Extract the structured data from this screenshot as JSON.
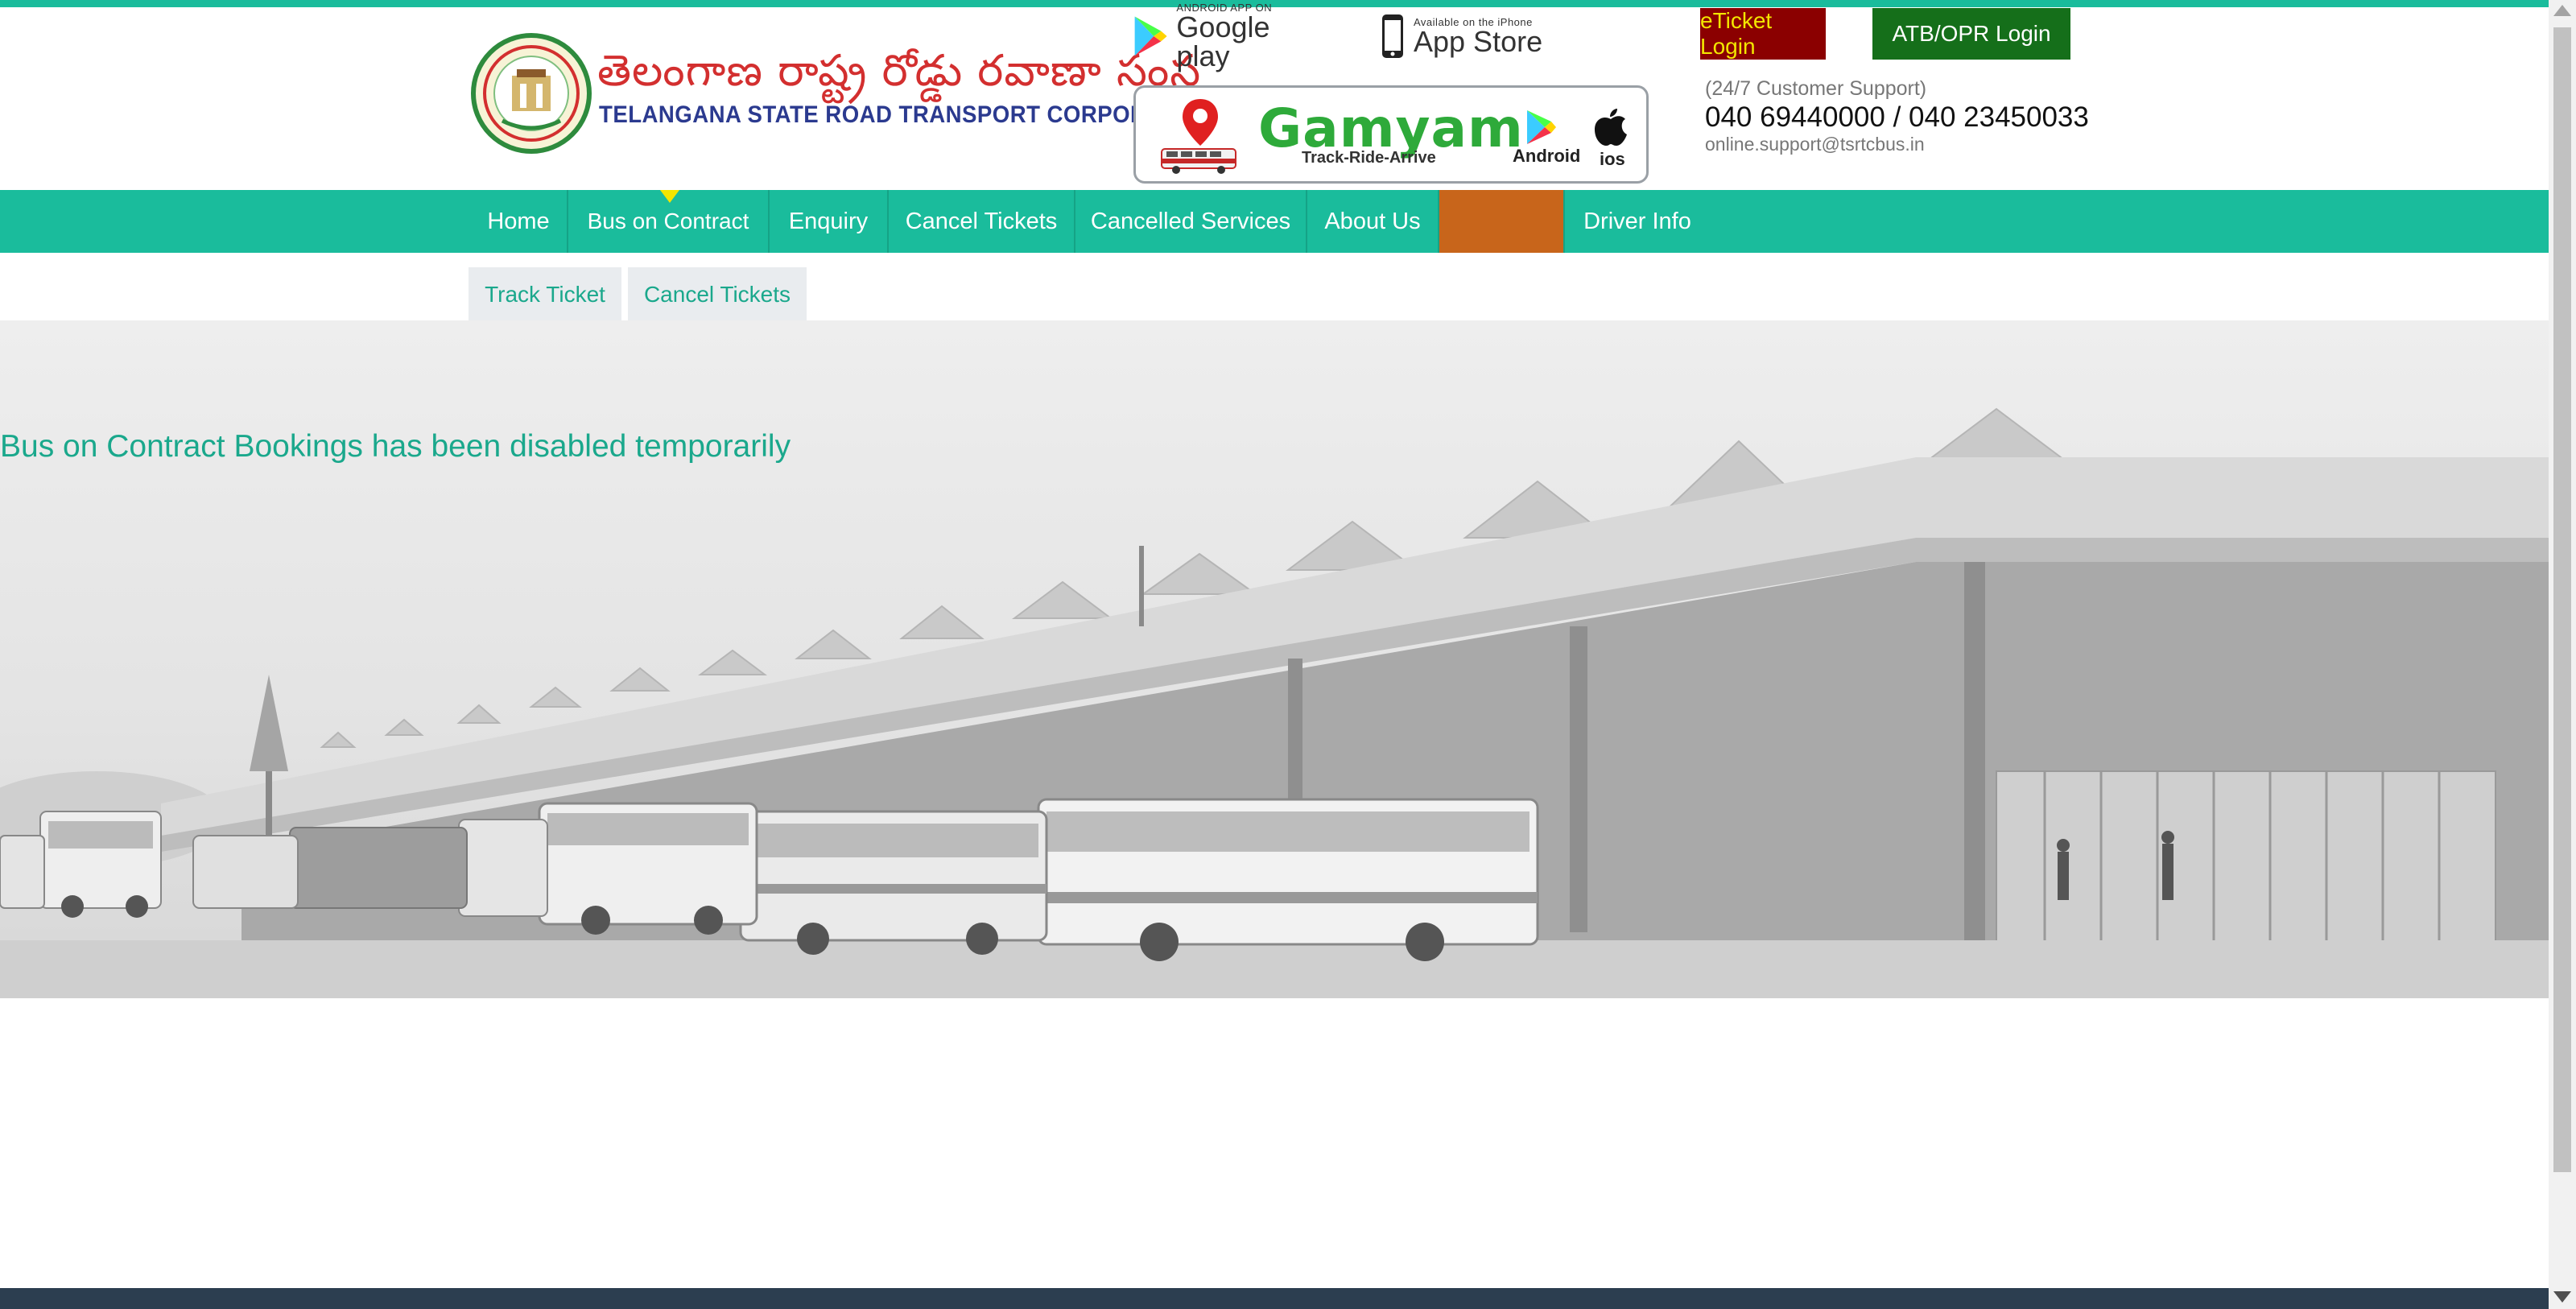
{
  "header": {
    "logo_telugu": "తెలంగాణ రాష్ట్ర రోడ్డు రవాణా సంస్థ",
    "logo_english": "TELANGANA STATE ROAD TRANSPORT CORPORATION",
    "google_play": {
      "small": "ANDROID APP ON",
      "big": "Google play"
    },
    "app_store": {
      "small": "Available on the iPhone",
      "big": "App Store"
    },
    "gamyam": {
      "title": "Gamyam",
      "tagline": "Track-Ride-Arrive",
      "android": "Android",
      "ios": "ios"
    },
    "eticket_login": "eTicket Login",
    "atb_login": "ATB/OPR Login",
    "support_label": "(24/7 Customer Support)",
    "support_phone": "040 69440000 / 040 23450033",
    "support_email": "online.support@tsrtcbus.in"
  },
  "nav": {
    "items": [
      {
        "label": "Home"
      },
      {
        "label": "Bus on Contract"
      },
      {
        "label": "Enquiry"
      },
      {
        "label": "Cancel Tickets"
      },
      {
        "label": "Cancelled Services"
      },
      {
        "label": "About Us"
      },
      {
        "label": ""
      },
      {
        "label": "Driver Info"
      }
    ],
    "active_index": 1
  },
  "subtabs": [
    {
      "label": "Track Ticket"
    },
    {
      "label": "Cancel Tickets"
    }
  ],
  "main": {
    "message": "Bus on Contract Bookings has been disabled temporarily"
  },
  "colors": {
    "primary": "#1abc9c",
    "eticket_bg": "#8b0000",
    "eticket_text": "#f3e600",
    "atb_bg": "#156f1a",
    "nav_highlight": "#c8651b",
    "footer": "#2c3e50"
  },
  "icons": [
    "tsrtc-emblem-icon",
    "google-play-icon",
    "apple-phone-icon",
    "location-pin-icon",
    "bus-icon",
    "play-store-icon",
    "apple-icon"
  ]
}
